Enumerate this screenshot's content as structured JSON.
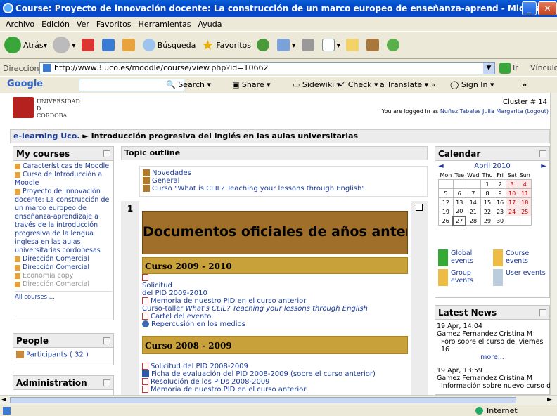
{
  "window": {
    "title": "Course: Proyecto de innovación docente: La construcción de un marco europeo de enseñanza-aprend - Microsoft Internet Explorer"
  },
  "menu": [
    "Archivo",
    "Edición",
    "Ver",
    "Favoritos",
    "Herramientas",
    "Ayuda"
  ],
  "toolbar": {
    "back": "Atrás",
    "search": "Búsqueda",
    "favorites": "Favoritos"
  },
  "address": {
    "label": "Dirección",
    "url": "http://www3.uco.es/moodle/course/view.php?id=10662",
    "go": "Ir",
    "links": "Vínculos"
  },
  "google": {
    "logo": "Google",
    "search": "Search",
    "share": "Share",
    "sidewiki": "Sidewiki",
    "check": "Check",
    "translate": "Translate",
    "signin": "Sign In"
  },
  "header": {
    "logo_line1": "UNIVERSIDAD",
    "logo_line2": "D",
    "logo_line3": "CORDOBA",
    "cluster": "Cluster # 14",
    "logged_prefix": "You are logged in as",
    "user": "Nuñez Tabales Julia Margarita",
    "logout": "(Logout)"
  },
  "breadcrumb": {
    "home": "e-learning Uco.",
    "sep": "►",
    "current": "Introducción progresiva del inglés en las aulas universitarias"
  },
  "mycourses": {
    "title": "My courses",
    "items": [
      "Características de Moodle",
      "Curso de Introducción a Moodle",
      "Proyecto de innovación docente: La construcción de un marco europeo de enseñanza-aprendizaje a través de la introducción progresiva de la lengua inglesa en las aulas universitarias cordobesas",
      "Dirección Comercial",
      "Dirección Comercial",
      "Economía copy",
      "Dirección Comercial"
    ],
    "all": "All courses ..."
  },
  "people": {
    "title": "People",
    "participants": "Participants ( 32 )"
  },
  "admin": {
    "title": "Administration"
  },
  "topic": {
    "title": "Topic outline",
    "top_items": [
      "Novedades",
      "General",
      "Curso \"What is CLIL? Teaching your lessons through English\""
    ],
    "section_num": "1",
    "banner": "Documentos oficiales de años anteriores",
    "sec1": {
      "title": "Curso 2009 - 2010",
      "l1": "Solicitud",
      "l2": "del PID 2009-2010",
      "l3": "Memoria de nuestro PID en el curso anterior",
      "l4a": "Curso-taller ",
      "l4b": "What's CLIL? Teaching your lessons through English",
      "l5": "Cartel del evento",
      "l6": "Repercusión en los medios"
    },
    "sec2": {
      "title": "Curso 2008 - 2009",
      "l1": "Solicitud del PID 2008-2009",
      "l2": "Ficha de evaluación del PID 2008-2009 (sobre el curso anterior)",
      "l3": "Resolución de los PIDs 2008-2009",
      "l4": "Memoria de nuestro PID en el curso anterior"
    }
  },
  "calendar": {
    "title": "Calendar",
    "month": "April 2010",
    "days": [
      "Mon",
      "Tue",
      "Wed",
      "Thu",
      "Fri",
      "Sat",
      "Sun"
    ],
    "weeks": [
      [
        "",
        "",
        "",
        "1",
        "2",
        "3",
        "4"
      ],
      [
        "5",
        "6",
        "7",
        "8",
        "9",
        "10",
        "11"
      ],
      [
        "12",
        "13",
        "14",
        "15",
        "16",
        "17",
        "18"
      ],
      [
        "19",
        "20",
        "21",
        "22",
        "23",
        "24",
        "25"
      ],
      [
        "26",
        "27",
        "28",
        "29",
        "30",
        "",
        ""
      ]
    ],
    "global": "Global events",
    "course": "Course events",
    "group": "Group events",
    "user": "User events"
  },
  "news": {
    "title": "Latest News",
    "d1": "19 Apr, 14:04",
    "a1": "Gamez Fernandez Cristina M",
    "t1": "Foro sobre el curso del viernes 16",
    "more": "more...",
    "d2": "19 Apr, 13:59",
    "a2": "Gamez Fernandez Cristina M",
    "t2": "Información sobre nuevo curso de"
  },
  "status": {
    "zone": "Internet"
  },
  "colors": {
    "titlebar": "#0246c4",
    "section_bar": "#c8a13a",
    "banner": "#a06f2a",
    "link": "#1a3b9e"
  }
}
